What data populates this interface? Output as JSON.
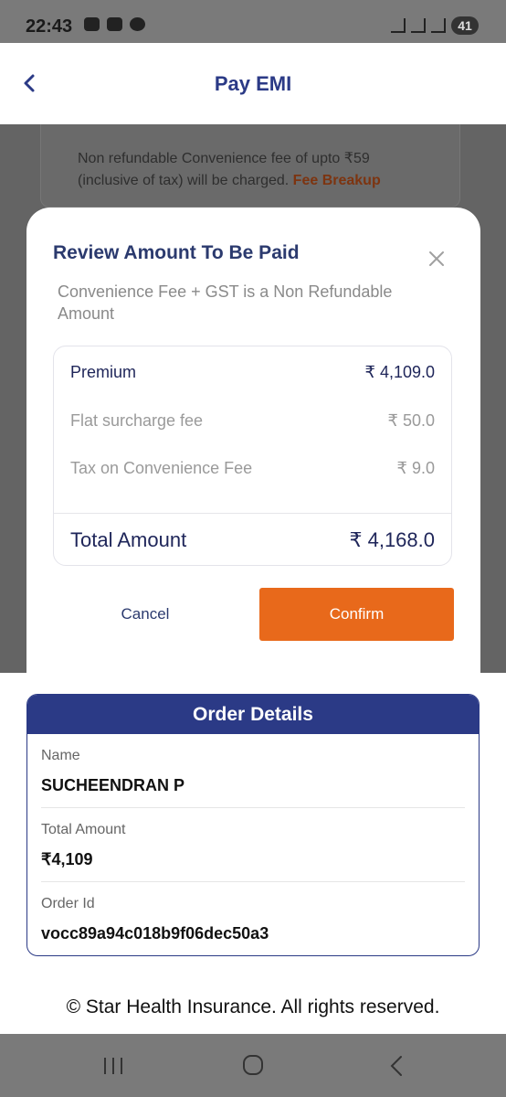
{
  "status_bar": {
    "time": "22:43",
    "battery": "41"
  },
  "header": {
    "title": "Pay EMI"
  },
  "background": {
    "fee_note": "Non refundable Convenience fee of upto ₹59 (inclusive of tax) will be charged.",
    "fee_link": "Fee Breakup"
  },
  "modal": {
    "title": "Review Amount To Be Paid",
    "subtitle": "Convenience Fee + GST is a Non Refundable Amount",
    "rows": [
      {
        "label": "Premium",
        "value": "₹ 4,109.0"
      },
      {
        "label": "Flat surcharge fee",
        "value": "₹ 50.0"
      },
      {
        "label": "Tax on Convenience Fee",
        "value": "₹ 9.0"
      }
    ],
    "total": {
      "label": "Total Amount",
      "value": "₹ 4,168.0"
    },
    "cancel_label": "Cancel",
    "confirm_label": "Confirm"
  },
  "order": {
    "title": "Order Details",
    "name_label": "Name",
    "name_value": "SUCHEENDRAN P",
    "amount_label": "Total Amount",
    "amount_value": "₹4,109",
    "id_label": "Order Id",
    "id_value": "vocc89a94c018b9f06dec50a3"
  },
  "footer": {
    "text": "© Star Health Insurance. All rights reserved."
  },
  "colors": {
    "brand": "#2b3a86",
    "confirm": "#e8691b"
  }
}
